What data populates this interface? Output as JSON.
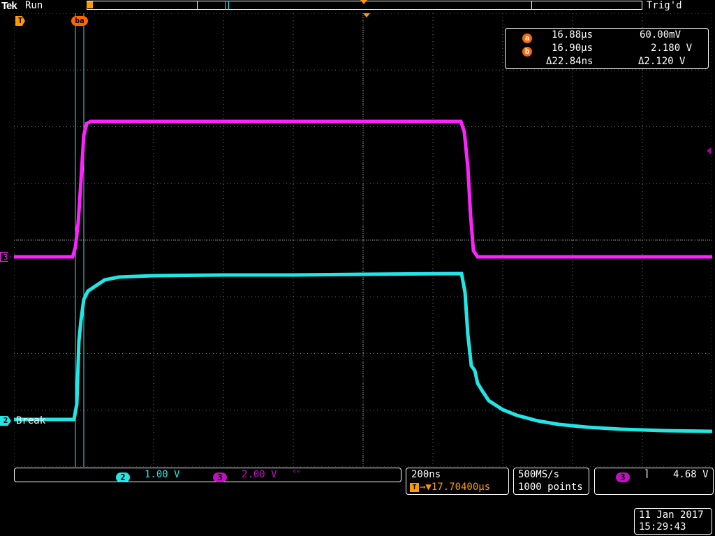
{
  "header": {
    "brand": "Tek",
    "run_state": "Run",
    "trigger_state": "Trig'd"
  },
  "markers": {
    "trigger_marker": "T",
    "cursor_marker": "ba",
    "ch3_marker": "3",
    "ch2_marker": "2",
    "ch2_label": "Break"
  },
  "readout": {
    "a_badge": "a",
    "a_time": "16.88µs",
    "a_value": "60.00mV",
    "b_badge": "b",
    "b_time": "16.90µs",
    "b_value": "2.180 V",
    "delta_time": "Δ22.84ns",
    "delta_value": "Δ2.120 V"
  },
  "channels": {
    "ch2_num": "2",
    "ch2_scale": "1.00 V",
    "ch3_num": "3",
    "ch3_scale": "2.00 V",
    "bw_symbol": "ᴮᵂ"
  },
  "timebase": {
    "scale": "200ns",
    "trigger_icon": "T",
    "position": "→▼17.70400µs"
  },
  "acquisition": {
    "sample_rate": "500MS/s",
    "points": "1000 points"
  },
  "trigger": {
    "source": "3",
    "slope_icon": "falling-edge-icon",
    "slope_glyph": "⌉",
    "level": "4.68 V"
  },
  "datetime": {
    "date": "11 Jan  2017",
    "time": "15:29:43"
  },
  "colors": {
    "ch2": "#22e6e6",
    "ch3": "#ff22ff",
    "cursor": "#ff6600",
    "trigger": "#ff9900",
    "grid": "#7a7a7a"
  }
}
